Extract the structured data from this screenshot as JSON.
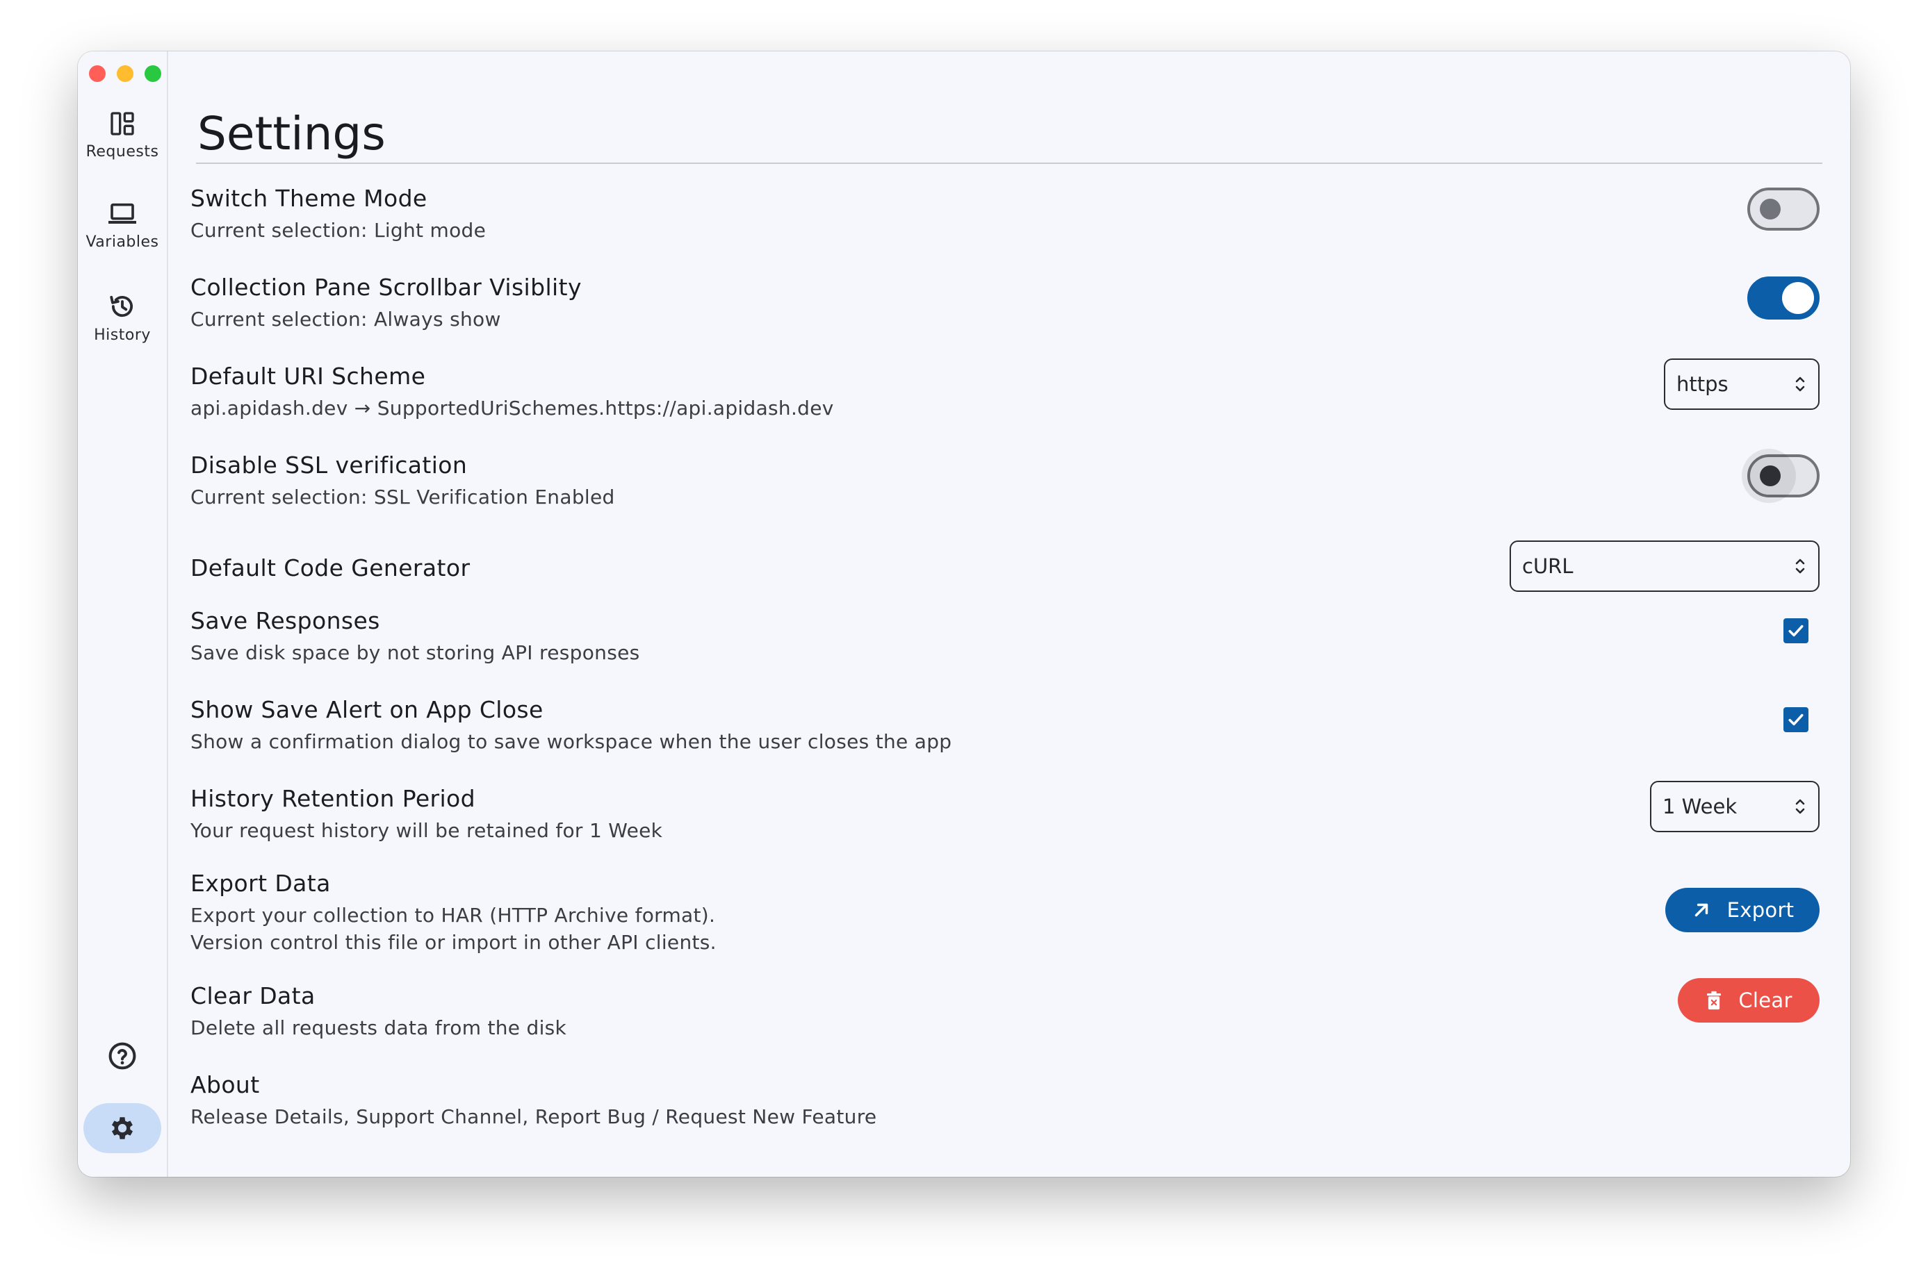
{
  "sidebar": {
    "items": [
      {
        "label": "Requests",
        "icon": "dashboard-icon"
      },
      {
        "label": "Variables",
        "icon": "laptop-icon"
      },
      {
        "label": "History",
        "icon": "history-icon"
      }
    ],
    "help_icon": "help-circle-icon",
    "settings_icon": "gear-icon",
    "active": "settings"
  },
  "page": {
    "title": "Settings"
  },
  "settings": {
    "theme": {
      "title": "Switch Theme Mode",
      "subtitle": "Current selection: Light mode",
      "enabled": false
    },
    "scrollbar": {
      "title": "Collection Pane Scrollbar Visiblity",
      "subtitle": "Current selection: Always show",
      "enabled": true
    },
    "uri_scheme": {
      "title": "Default URI Scheme",
      "subtitle": "api.apidash.dev → SupportedUriSchemes.https://api.apidash.dev",
      "value": "https"
    },
    "ssl": {
      "title": "Disable SSL verification",
      "subtitle": "Current selection: SSL Verification Enabled",
      "enabled": false
    },
    "codegen": {
      "title": "Default Code Generator",
      "value": "cURL"
    },
    "save_responses": {
      "title": "Save Responses",
      "subtitle": "Save disk space by not storing API responses",
      "checked": true
    },
    "save_alert": {
      "title": "Show Save Alert on App Close",
      "subtitle": "Show a confirmation dialog to save workspace when the user closes the app",
      "checked": true
    },
    "history": {
      "title": "History Retention Period",
      "subtitle": "Your request history will be retained for 1 Week",
      "value": "1 Week"
    },
    "export": {
      "title": "Export Data",
      "line1": "Export your collection to HAR (HTTP Archive format).",
      "line2": "Version control this file or import in other API clients.",
      "button": "Export",
      "icon": "arrow-up-right-icon"
    },
    "clear": {
      "title": "Clear Data",
      "subtitle": "Delete all requests data from the disk",
      "button": "Clear",
      "icon": "trash-icon"
    },
    "about": {
      "title": "About",
      "subtitle": "Release Details, Support Channel, Report Bug / Request New Feature"
    }
  },
  "colors": {
    "accent": "#0c5ea8",
    "danger": "#ec5148",
    "active_nav": "#c9dcf7"
  }
}
